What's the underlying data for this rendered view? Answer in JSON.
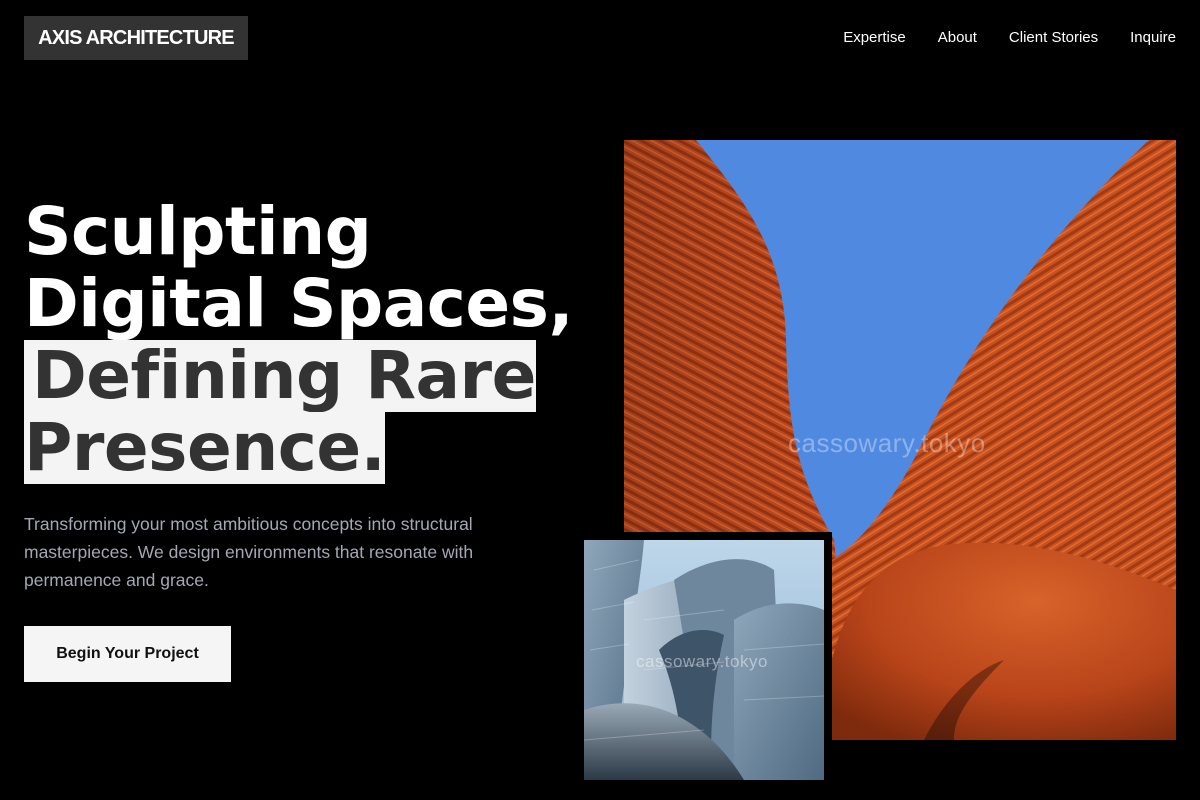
{
  "header": {
    "logo": "AXIS ARCHITECTURE",
    "nav": [
      "Expertise",
      "About",
      "Client Stories",
      "Inquire"
    ]
  },
  "hero": {
    "line1": "Sculpting",
    "line2": "Digital Spaces,",
    "line3": "Defining Rare",
    "line4": "Presence.",
    "subtitle": "Transforming your most ambitious concepts into structural masterpieces. We design environments that resonate with permanence and grace.",
    "cta": "Begin Your Project"
  },
  "images": {
    "watermark_main": "cassowary.tokyo",
    "watermark_small": "cassowary.tokyo"
  },
  "colors": {
    "background": "#000000",
    "logo_bg": "#333333",
    "highlight_bg": "#f4f4f4",
    "highlight_text": "#333333",
    "subtitle": "#a3a8b3",
    "sky": "#5089e0",
    "facade": "#c5481d"
  }
}
